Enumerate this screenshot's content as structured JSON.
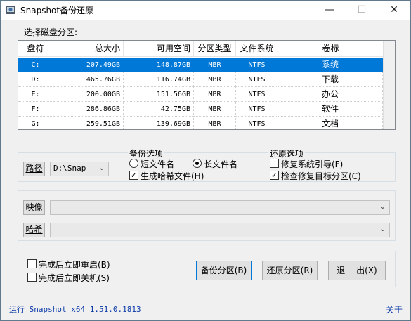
{
  "window": {
    "title": "Snapshot备份还原",
    "minimize_glyph": "—",
    "maximize_glyph": "☐",
    "close_glyph": "✕"
  },
  "partition_label": "选择磁盘分区:",
  "table": {
    "columns": [
      "盘符",
      "总大小",
      "可用空间",
      "分区类型",
      "文件系统",
      "卷标"
    ],
    "rows": [
      {
        "drive": "C:",
        "total": "207.49GB",
        "free": "148.87GB",
        "type": "MBR",
        "fs": "NTFS",
        "label": "系统",
        "selected": true
      },
      {
        "drive": "D:",
        "total": "465.76GB",
        "free": "116.74GB",
        "type": "MBR",
        "fs": "NTFS",
        "label": "下载",
        "selected": false
      },
      {
        "drive": "E:",
        "total": "200.00GB",
        "free": "151.56GB",
        "type": "MBR",
        "fs": "NTFS",
        "label": "办公",
        "selected": false
      },
      {
        "drive": "F:",
        "total": "286.86GB",
        "free": "42.75GB",
        "type": "MBR",
        "fs": "NTFS",
        "label": "软件",
        "selected": false
      },
      {
        "drive": "G:",
        "total": "259.51GB",
        "free": "139.69GB",
        "type": "MBR",
        "fs": "NTFS",
        "label": "文档",
        "selected": false
      }
    ]
  },
  "path": {
    "button_label": "路径",
    "combo_value": "D:\\Snap"
  },
  "backup_options": {
    "title": "备份选项",
    "short_name": "短文件名",
    "long_name": "长文件名",
    "long_name_selected": true,
    "gen_hash": "生成哈希文件(H)",
    "gen_hash_checked": true
  },
  "restore_options": {
    "title": "还原选项",
    "fix_boot": "修复系统引导(F)",
    "fix_boot_checked": false,
    "check_fix": "检查修复目标分区(C)",
    "check_fix_checked": true
  },
  "image": {
    "button_label": "映像",
    "value": ""
  },
  "hash": {
    "button_label": "哈希",
    "value": ""
  },
  "finish": {
    "restart": "完成后立即重启(B)",
    "shutdown": "完成后立即关机(S)"
  },
  "actions": {
    "backup": "备份分区(B)",
    "restore": "还原分区(R)",
    "exit": "退　 出(X)"
  },
  "status": {
    "text": "运行 Snapshot x64 1.51.0.1813",
    "about": "关于"
  }
}
